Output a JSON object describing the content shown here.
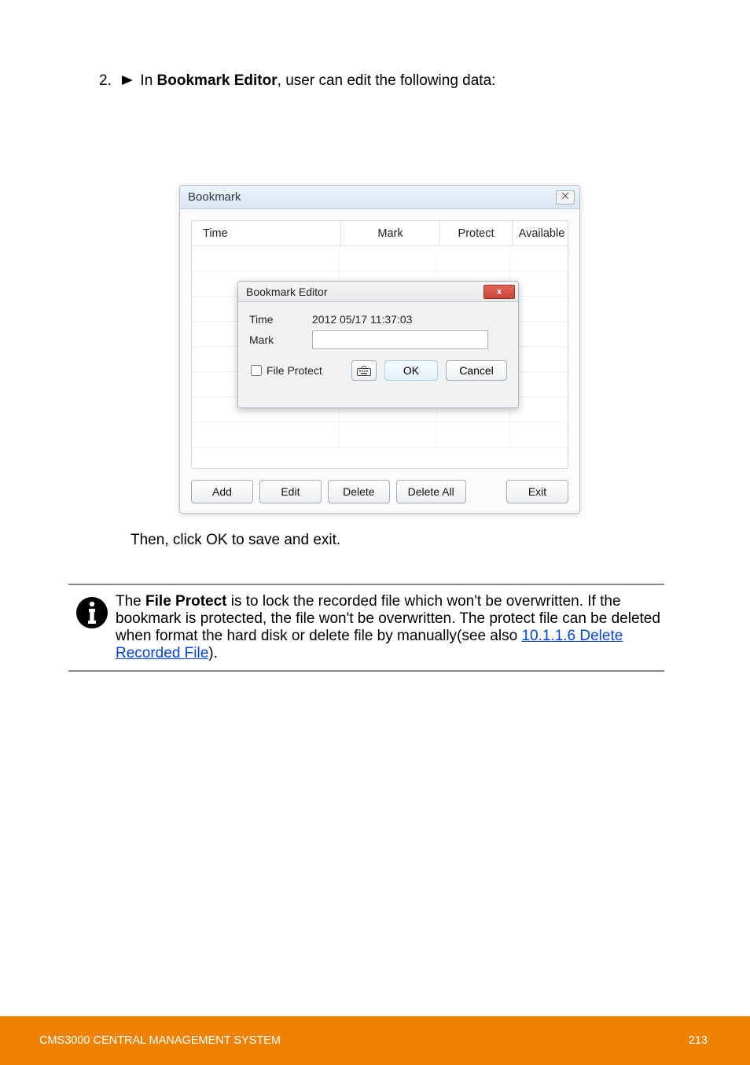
{
  "step": {
    "num": "2.",
    "prefix": "In ",
    "bold": "Bookmark Editor",
    "cont": ", user can edit the following data:"
  },
  "bookmark_window": {
    "title": "Bookmark",
    "close_glyph": "⨉",
    "columns": {
      "time": "Time",
      "mark": "Mark",
      "protect": "Protect",
      "available": "Available"
    },
    "buttons": {
      "add": "Add",
      "edit": "Edit",
      "delete": "Delete",
      "delete_all": "Delete All",
      "exit": "Exit"
    }
  },
  "editor": {
    "title": "Bookmark Editor",
    "close_glyph": "x",
    "time_label": "Time",
    "time_value": "2012 05/17 11:37:03",
    "mark_label": "Mark",
    "mark_value": "",
    "file_protect_label": "File Protect",
    "ok": "OK",
    "cancel": "Cancel"
  },
  "after": {
    "line1": "Then, click OK to save and exit."
  },
  "note": {
    "line1a": "The",
    "line1b": " File Protect",
    "line1c": " is to lock the recorded file which won't be overwritten. If the bookmark is protected, the file won't be overwritten. The protect file can be deleted when format the hard disk or delete file by manually(see also ",
    "link_text": "10.1.1.6 Delete Recorded File",
    "line1d": ")."
  },
  "footer": {
    "left": "CMS3000 CENTRAL MANAGEMENT SYSTEM",
    "right": "213"
  }
}
